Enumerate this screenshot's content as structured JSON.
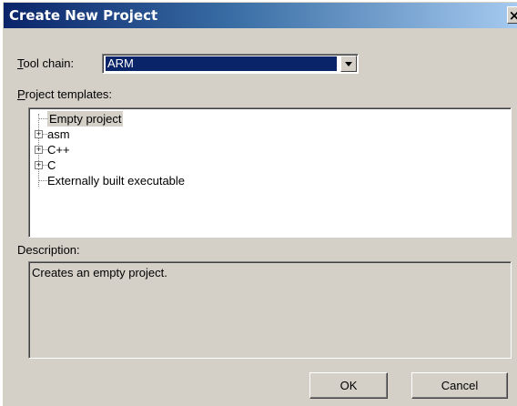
{
  "window": {
    "title": "Create New Project"
  },
  "toolchain": {
    "label_mnemonic": "T",
    "label_rest": "ool chain:",
    "value": "ARM"
  },
  "templates": {
    "label_mnemonic": "P",
    "label_rest": "roject templates:",
    "items": [
      {
        "label": "Empty project",
        "expandable": false,
        "selected": true
      },
      {
        "label": "asm",
        "expandable": true,
        "selected": false
      },
      {
        "label": "C++",
        "expandable": true,
        "selected": false
      },
      {
        "label": "C",
        "expandable": true,
        "selected": false
      },
      {
        "label": "Externally built executable",
        "expandable": false,
        "selected": false
      }
    ]
  },
  "description": {
    "label": "Description:",
    "text": "Creates an empty project."
  },
  "buttons": {
    "ok": "OK",
    "cancel": "Cancel"
  },
  "icons": {
    "close": "close-icon",
    "dropdown": "chevron-down-icon",
    "expander": "plus-box-icon"
  },
  "colors": {
    "title_start": "#0a246a",
    "title_end": "#a6caf0",
    "selection": "#0a246a",
    "face": "#d4d0c8"
  }
}
